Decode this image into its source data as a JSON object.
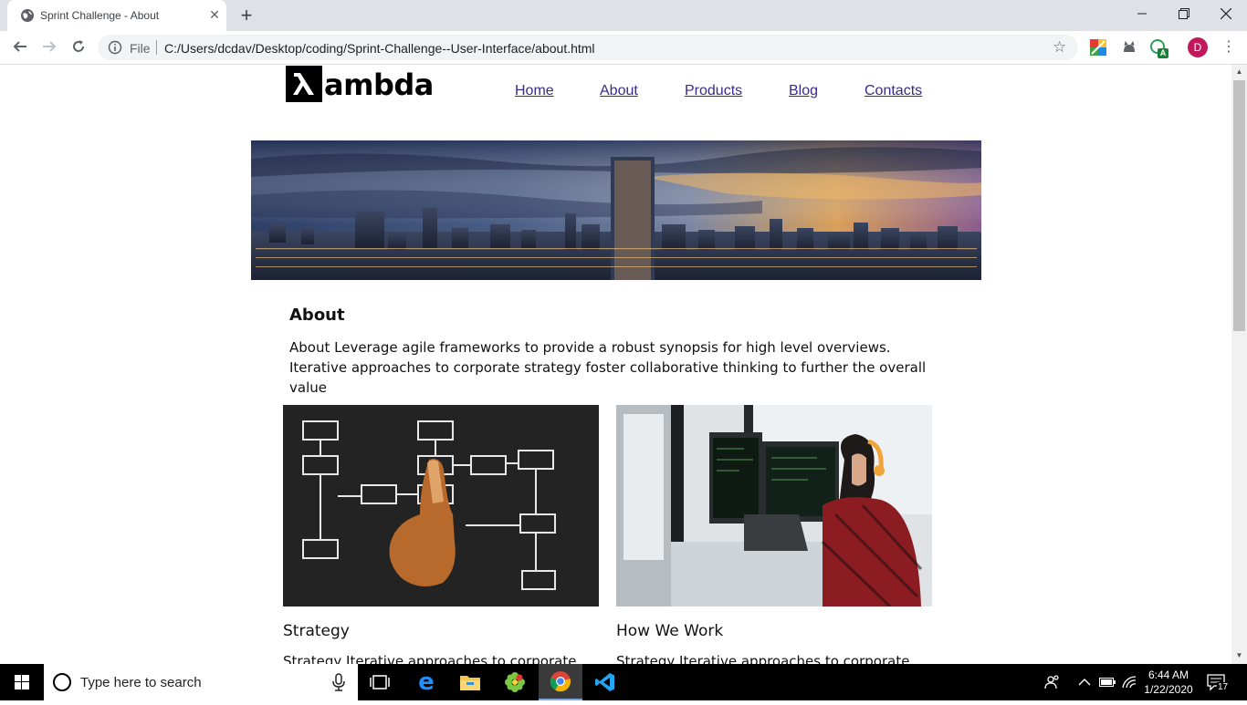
{
  "browser": {
    "tab_title": "Sprint Challenge - About",
    "scheme_label": "File",
    "url": "C:/Users/dcdav/Desktop/coding/Sprint-Challenge--User-Interface/about.html",
    "profile_initial": "D",
    "extension_badge": "A"
  },
  "site": {
    "logo_text": "ambda",
    "nav": [
      "Home",
      "About",
      "Products",
      "Blog",
      "Contacts"
    ],
    "about": {
      "title": "About",
      "text": "About Leverage agile frameworks to provide a robust synopsis for high level overviews. Iterative approaches to corporate strategy foster collaborative thinking to further the overall value"
    },
    "cards": [
      {
        "title": "Strategy",
        "text": "Strategy Iterative approaches to corporate"
      },
      {
        "title": "How We Work",
        "text": "Strategy Iterative approaches to corporate"
      }
    ]
  },
  "taskbar": {
    "search_placeholder": "Type here to search",
    "time": "6:44 AM",
    "date": "1/22/2020",
    "notification_count": "17"
  }
}
